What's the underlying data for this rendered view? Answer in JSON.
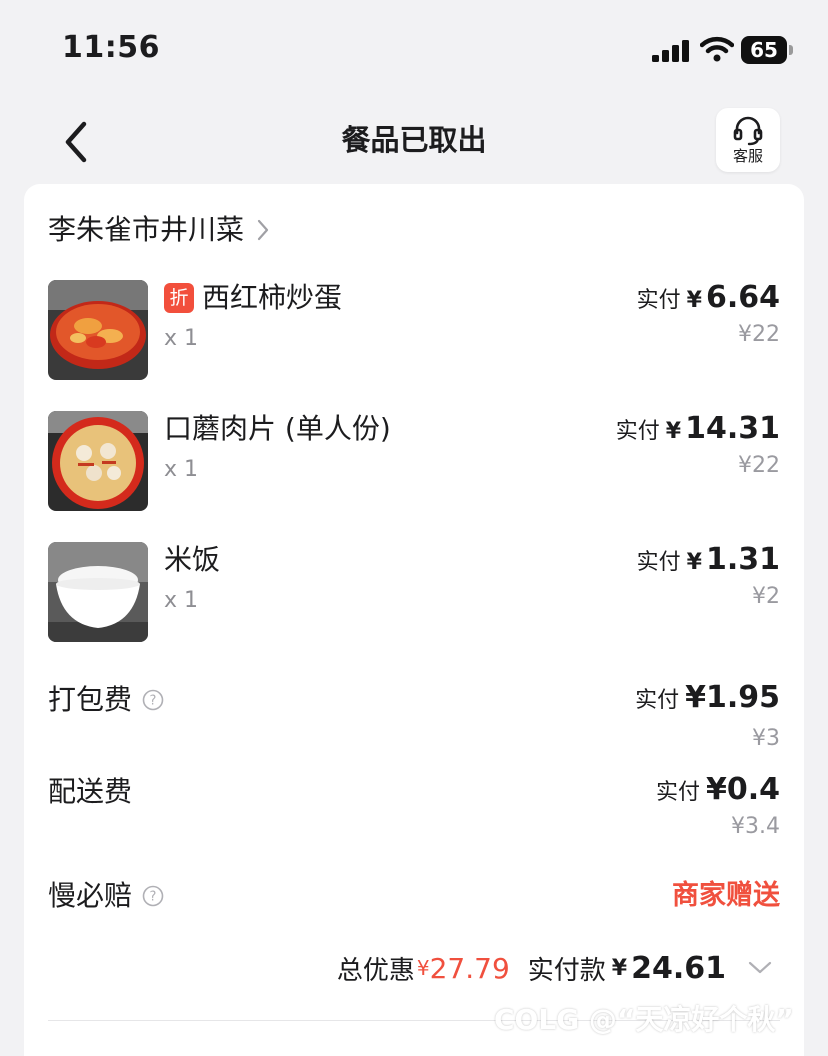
{
  "status_bar": {
    "time": "11:56",
    "battery": "65",
    "icons": [
      "cellular-signal-icon",
      "wifi-icon",
      "battery-icon"
    ]
  },
  "nav": {
    "title": "餐品已取出",
    "service_label": "客服",
    "icons": [
      "back-arrow-icon",
      "headset-icon"
    ]
  },
  "shop": {
    "name": "李朱雀市井川菜"
  },
  "items": [
    {
      "name": "西红柿炒蛋",
      "badge": "折",
      "qty": "x 1",
      "paid_label": "实付",
      "paid_yen": "¥",
      "paid_amount": "6.64",
      "original": "¥22",
      "image": "tomato-egg-dish"
    },
    {
      "name": "口蘑肉片 (单人份)",
      "badge": "",
      "qty": "x 1",
      "paid_label": "实付",
      "paid_yen": "¥",
      "paid_amount": "14.31",
      "original": "¥22",
      "image": "mushroom-pork-dish"
    },
    {
      "name": "米饭",
      "badge": "",
      "qty": "x 1",
      "paid_label": "实付",
      "paid_yen": "¥",
      "paid_amount": "1.31",
      "original": "¥2",
      "image": "rice-bowl"
    }
  ],
  "fees": {
    "packing": {
      "label": "打包费",
      "paid_label": "实付",
      "paid_value": "¥1.95",
      "original": "¥3"
    },
    "delivery": {
      "label": "配送费",
      "paid_label": "实付",
      "paid_value": "¥0.4",
      "original": "¥3.4"
    },
    "late": {
      "label": "慢必赔",
      "value": "商家赠送"
    }
  },
  "summary": {
    "discount_label": "总优惠",
    "discount_yen": "¥",
    "discount_value": "27.79",
    "paid_label": "实付款",
    "paid_yen": "¥",
    "paid_value": "24.61"
  },
  "watermark": "COLG @“天凉好个秋”",
  "colors": {
    "accent_red": "#f0503e",
    "background": "#f2f2f4",
    "muted": "#9a9aa0"
  }
}
